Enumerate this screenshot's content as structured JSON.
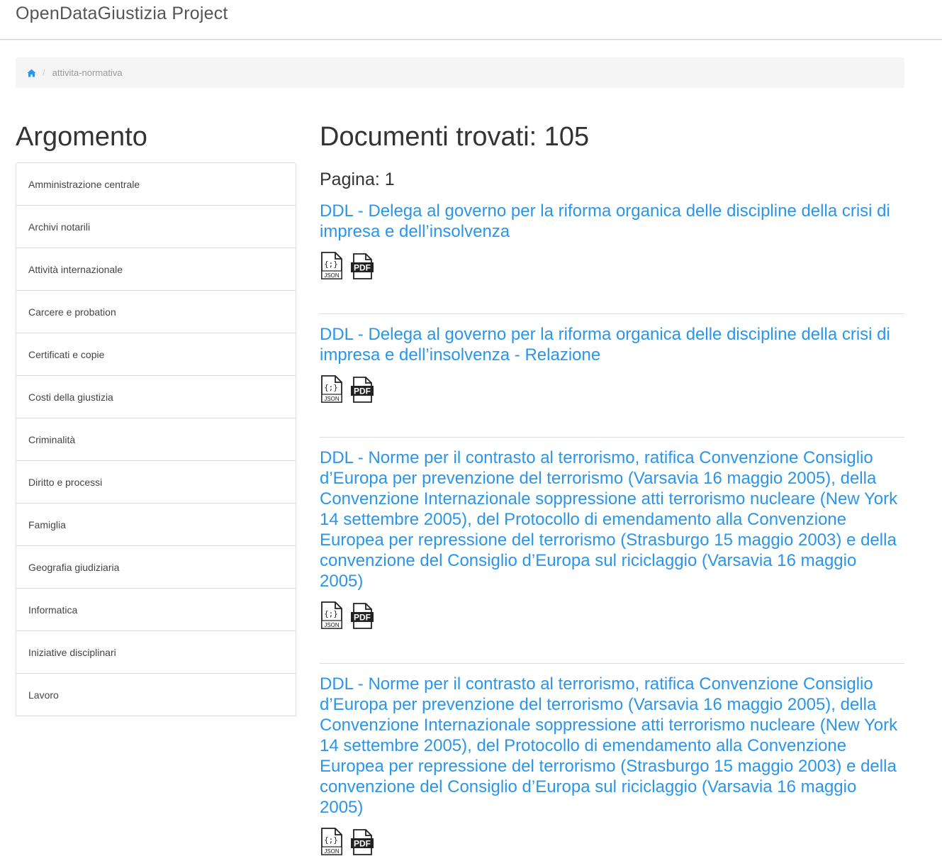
{
  "navbar": {
    "brand": "OpenDataGiustizia Project"
  },
  "breadcrumb": {
    "home_icon": "home-icon",
    "separator": "/",
    "current": "attivita-normativa"
  },
  "sidebar": {
    "title": "Argomento",
    "items": [
      {
        "label": "Amministrazione centrale"
      },
      {
        "label": "Archivi notarili"
      },
      {
        "label": "Attività internazionale"
      },
      {
        "label": "Carcere e probation"
      },
      {
        "label": "Certificati e copie"
      },
      {
        "label": "Costi della giustizia"
      },
      {
        "label": "Criminalità"
      },
      {
        "label": "Diritto e processi"
      },
      {
        "label": "Famiglia"
      },
      {
        "label": "Geografia giudiziaria"
      },
      {
        "label": "Informatica"
      },
      {
        "label": "Iniziative disciplinari"
      },
      {
        "label": "Lavoro"
      }
    ]
  },
  "main": {
    "count_title": "Documenti trovati: 105",
    "page_label": "Pagina: 1",
    "documents": [
      {
        "title": "DDL - Delega al governo per la riforma organica delle discipline della crisi di impresa e dell’insolvenza",
        "formats": [
          "JSON",
          "PDF"
        ]
      },
      {
        "title": "DDL - Delega al governo per la riforma organica delle discipline della crisi di impresa e dell’insolvenza - Relazione",
        "formats": [
          "JSON",
          "PDF"
        ]
      },
      {
        "title": "DDL - Norme per il contrasto al terrorismo, ratifica Convenzione Consiglio d’Europa per prevenzione del terrorismo (Varsavia 16 maggio 2005), della Convenzione Internazionale soppressione atti terrorismo nucleare (New York 14 settembre 2005), del Protocollo di emendamento alla Convenzione Europea per repressione del terrorismo (Strasburgo 15 maggio 2003) e della convenzione del Consiglio d’Europa sul riciclaggio (Varsavia 16 maggio 2005)",
        "formats": [
          "JSON",
          "PDF"
        ]
      },
      {
        "title": "DDL - Norme per il contrasto al terrorismo, ratifica Convenzione Consiglio d’Europa per prevenzione del terrorismo (Varsavia 16 maggio 2005), della Convenzione Internazionale soppressione atti terrorismo nucleare (New York 14 settembre 2005), del Protocollo di emendamento alla Convenzione Europea per repressione del terrorismo (Strasburgo 15 maggio 2003) e della convenzione del Consiglio d’Europa sul riciclaggio (Varsavia 16 maggio 2005)",
        "formats": [
          "JSON",
          "PDF"
        ]
      }
    ]
  },
  "colors": {
    "link": "#2b95e9",
    "breadcrumb_bg": "#f5f5f5",
    "border": "#dddddd"
  }
}
